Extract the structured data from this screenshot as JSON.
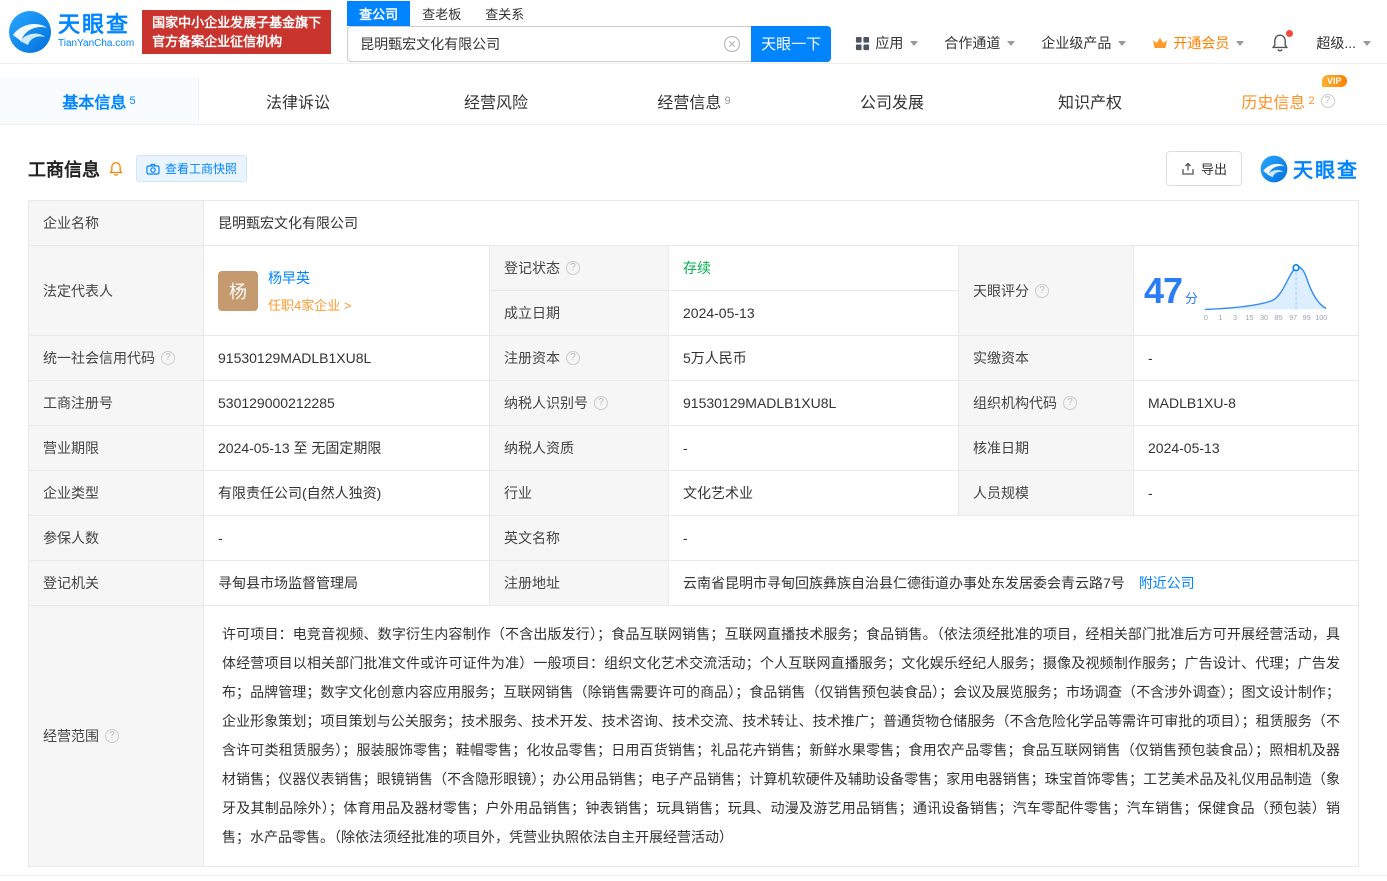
{
  "colors": {
    "brand_blue": "#0084ff",
    "status_green": "#00b34a",
    "vip_orange": "#ff8000",
    "badge_red": "#c9342e",
    "score_blue": "#2b7cf7"
  },
  "header": {
    "logo": {
      "title": "天眼查",
      "subtitle": "TianYanCha.com"
    },
    "badge": {
      "line1": "国家中小企业发展子基金旗下",
      "line2": "官方备案企业征信机构"
    },
    "search": {
      "tabs": [
        {
          "label": "查公司"
        },
        {
          "label": "查老板"
        },
        {
          "label": "查关系"
        }
      ],
      "value": "昆明甄宏文化有限公司",
      "button": "天眼一下"
    },
    "nav": {
      "apps": "应用",
      "cooperation": "合作通道",
      "enterprise": "企业级产品",
      "vip": "开通会员",
      "account": "超级..."
    }
  },
  "tabs": [
    {
      "label": "基本信息",
      "count": "5"
    },
    {
      "label": "法律诉讼",
      "count": ""
    },
    {
      "label": "经营风险",
      "count": ""
    },
    {
      "label": "经营信息",
      "count": "9"
    },
    {
      "label": "公司发展",
      "count": ""
    },
    {
      "label": "知识产权",
      "count": ""
    },
    {
      "label": "历史信息",
      "count": "2",
      "badge": "VIP"
    }
  ],
  "section": {
    "title": "工商信息",
    "snapshot_button": "查看工商快照",
    "export_button": "导出",
    "brand": "天眼查"
  },
  "score": {
    "label": "天眼评分",
    "value": "47",
    "unit": "分",
    "axis": [
      "0",
      "1",
      "3",
      "15",
      "30",
      "85",
      "97",
      "99",
      "100"
    ]
  },
  "fields": {
    "company_name": {
      "label": "企业名称",
      "value": "昆明甄宏文化有限公司"
    },
    "legal_rep": {
      "label": "法定代表人",
      "avatar": "杨",
      "name": "杨早英",
      "positions": "任职4家企业 >"
    },
    "reg_status": {
      "label": "登记状态",
      "value": "存续"
    },
    "establish_date": {
      "label": "成立日期",
      "value": "2024-05-13"
    },
    "credit_code": {
      "label": "统一社会信用代码",
      "value": "91530129MADLB1XU8L"
    },
    "reg_capital": {
      "label": "注册资本",
      "value": "5万人民币"
    },
    "paid_capital": {
      "label": "实缴资本",
      "value": "-"
    },
    "reg_number": {
      "label": "工商注册号",
      "value": "530129000212285"
    },
    "taxpayer_id": {
      "label": "纳税人识别号",
      "value": "91530129MADLB1XU8L"
    },
    "org_code": {
      "label": "组织机构代码",
      "value": "MADLB1XU-8"
    },
    "business_term": {
      "label": "营业期限",
      "value": "2024-05-13 至 无固定期限"
    },
    "taxpayer_quality": {
      "label": "纳税人资质",
      "value": "-"
    },
    "approve_date": {
      "label": "核准日期",
      "value": "2024-05-13"
    },
    "company_type": {
      "label": "企业类型",
      "value": "有限责任公司(自然人独资)"
    },
    "industry": {
      "label": "行业",
      "value": "文化艺术业"
    },
    "staff_size": {
      "label": "人员规模",
      "value": "-"
    },
    "insured_count": {
      "label": "参保人数",
      "value": "-"
    },
    "english_name": {
      "label": "英文名称",
      "value": "-"
    },
    "reg_authority": {
      "label": "登记机关",
      "value": "寻甸县市场监督管理局"
    },
    "reg_address": {
      "label": "注册地址",
      "value": "云南省昆明市寻甸回族彝族自治县仁德街道办事处东发居委会青云路7号",
      "link": "附近公司"
    },
    "business_scope": {
      "label": "经营范围",
      "value": "许可项目：电竞音视频、数字衍生内容制作（不含出版发行）；食品互联网销售；互联网直播技术服务；食品销售。（依法须经批准的项目，经相关部门批准后方可开展经营活动，具体经营项目以相关部门批准文件或许可证件为准）一般项目：组织文化艺术交流活动；个人互联网直播服务；文化娱乐经纪人服务；摄像及视频制作服务；广告设计、代理；广告发布；品牌管理；数字文化创意内容应用服务；互联网销售（除销售需要许可的商品）；食品销售（仅销售预包装食品）；会议及展览服务；市场调查（不含涉外调查）；图文设计制作；企业形象策划；项目策划与公关服务；技术服务、技术开发、技术咨询、技术交流、技术转让、技术推广；普通货物仓储服务（不含危险化学品等需许可审批的项目）；租赁服务（不含许可类租赁服务）；服装服饰零售；鞋帽零售；化妆品零售；日用百货销售；礼品花卉销售；新鲜水果零售；食用农产品零售；食品互联网销售（仅销售预包装食品）；照相机及器材销售；仪器仪表销售；眼镜销售（不含隐形眼镜）；办公用品销售；电子产品销售；计算机软硬件及辅助设备零售；家用电器销售；珠宝首饰零售；工艺美术品及礼仪用品制造（象牙及其制品除外）；体育用品及器材零售；户外用品销售；钟表销售；玩具销售；玩具、动漫及游艺用品销售；通讯设备销售；汽车零配件零售；汽车销售；保健食品（预包装）销售；水产品零售。（除依法须经批准的项目外，凭营业执照依法自主开展经营活动）"
    }
  }
}
